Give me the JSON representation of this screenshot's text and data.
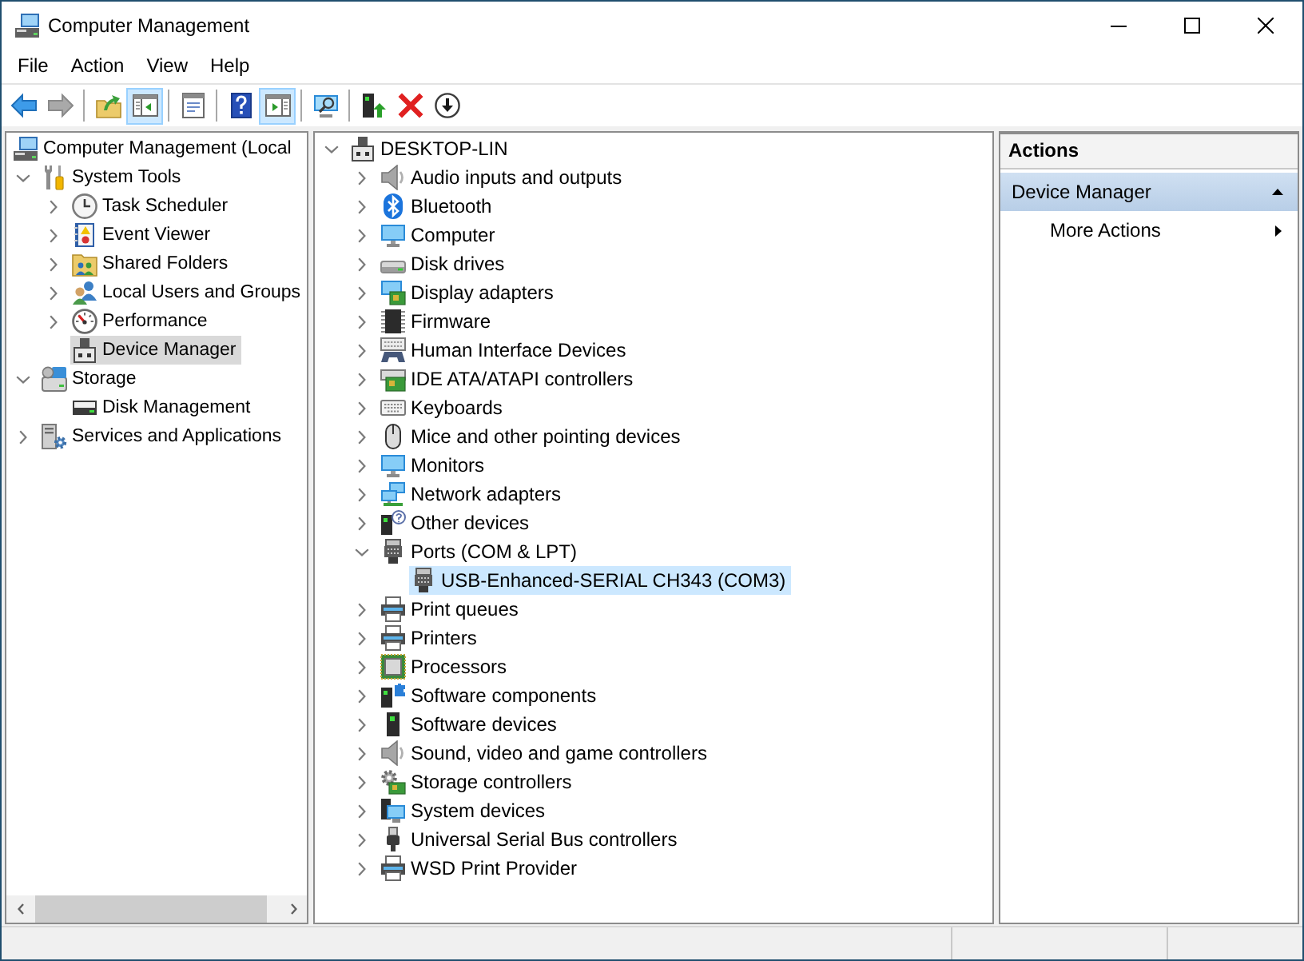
{
  "window": {
    "title": "Computer Management"
  },
  "menu": [
    {
      "label": "File"
    },
    {
      "label": "Action"
    },
    {
      "label": "View"
    },
    {
      "label": "Help"
    }
  ],
  "toolbar": {
    "groups": [
      {
        "buttons": [
          {
            "pressed": false,
            "disabled": false
          },
          {
            "pressed": false,
            "disabled": true
          }
        ]
      },
      {
        "buttons": [
          {
            "pressed": false,
            "disabled": false
          },
          {
            "pressed": true,
            "disabled": false
          }
        ]
      },
      {
        "buttons": [
          {
            "pressed": false,
            "disabled": false
          }
        ]
      },
      {
        "buttons": [
          {
            "pressed": false,
            "disabled": false
          },
          {
            "pressed": true,
            "disabled": false
          }
        ]
      },
      {
        "buttons": [
          {
            "pressed": false,
            "disabled": false
          }
        ]
      },
      {
        "buttons": [
          {
            "pressed": false,
            "disabled": false
          },
          {
            "pressed": false,
            "disabled": false
          },
          {
            "pressed": false,
            "disabled": false
          }
        ]
      }
    ]
  },
  "console_tree": {
    "focused": false,
    "items": [
      {
        "label": "Computer Management (Local",
        "selected": false,
        "children": [
          {
            "label": "System Tools",
            "expanded": true,
            "selected": false,
            "children": [
              {
                "label": "Task Scheduler",
                "expanded": false,
                "selected": false
              },
              {
                "label": "Event Viewer",
                "expanded": false,
                "selected": false
              },
              {
                "label": "Shared Folders",
                "expanded": false,
                "selected": false
              },
              {
                "label": "Local Users and Groups",
                "expanded": false,
                "selected": false
              },
              {
                "label": "Performance",
                "expanded": false,
                "selected": false
              },
              {
                "label": "Device Manager",
                "selected": true
              }
            ]
          },
          {
            "label": "Storage",
            "expanded": true,
            "selected": false,
            "children": [
              {
                "label": "Disk Management",
                "selected": false
              }
            ]
          },
          {
            "label": "Services and Applications",
            "expanded": false,
            "selected": false
          }
        ]
      }
    ]
  },
  "device_tree": {
    "focused": true,
    "items": [
      {
        "label": "DESKTOP-LIN",
        "expanded": true,
        "selected": false,
        "children": [
          {
            "label": "Audio inputs and outputs",
            "expanded": false,
            "selected": false
          },
          {
            "label": "Bluetooth",
            "expanded": false,
            "selected": false
          },
          {
            "label": "Computer",
            "expanded": false,
            "selected": false
          },
          {
            "label": "Disk drives",
            "expanded": false,
            "selected": false
          },
          {
            "label": "Display adapters",
            "expanded": false,
            "selected": false
          },
          {
            "label": "Firmware",
            "expanded": false,
            "selected": false
          },
          {
            "label": "Human Interface Devices",
            "expanded": false,
            "selected": false
          },
          {
            "label": "IDE ATA/ATAPI controllers",
            "expanded": false,
            "selected": false
          },
          {
            "label": "Keyboards",
            "expanded": false,
            "selected": false
          },
          {
            "label": "Mice and other pointing devices",
            "expanded": false,
            "selected": false
          },
          {
            "label": "Monitors",
            "expanded": false,
            "selected": false
          },
          {
            "label": "Network adapters",
            "expanded": false,
            "selected": false
          },
          {
            "label": "Other devices",
            "expanded": false,
            "selected": false
          },
          {
            "label": "Ports (COM & LPT)",
            "expanded": true,
            "selected": false,
            "children": [
              {
                "label": "USB-Enhanced-SERIAL CH343 (COM3)",
                "selected": true
              }
            ]
          },
          {
            "label": "Print queues",
            "expanded": false,
            "selected": false
          },
          {
            "label": "Printers",
            "expanded": false,
            "selected": false
          },
          {
            "label": "Processors",
            "expanded": false,
            "selected": false
          },
          {
            "label": "Software components",
            "expanded": false,
            "selected": false
          },
          {
            "label": "Software devices",
            "expanded": false,
            "selected": false
          },
          {
            "label": "Sound, video and game controllers",
            "expanded": false,
            "selected": false
          },
          {
            "label": "Storage controllers",
            "expanded": false,
            "selected": false
          },
          {
            "label": "System devices",
            "expanded": false,
            "selected": false
          },
          {
            "label": "Universal Serial Bus controllers",
            "expanded": false,
            "selected": false
          },
          {
            "label": "WSD Print Provider",
            "expanded": false,
            "selected": false
          }
        ]
      }
    ]
  },
  "actions": {
    "title": "Actions",
    "sections": [
      {
        "label": "Device Manager",
        "expanded": true,
        "items": [
          {
            "label": "More Actions"
          }
        ]
      }
    ]
  }
}
